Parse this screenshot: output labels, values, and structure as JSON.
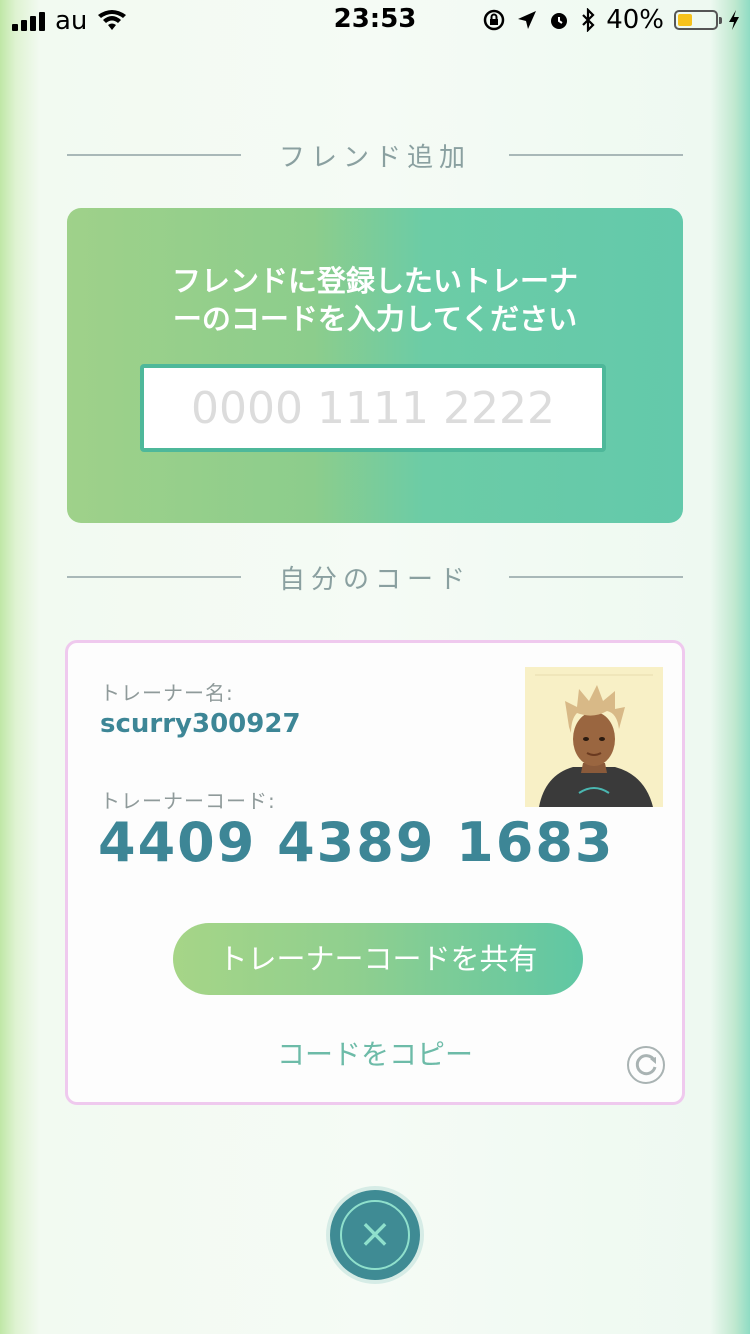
{
  "status_bar": {
    "carrier": "au",
    "time": "23:53",
    "battery_percent": "40%",
    "battery_level": 0.4,
    "icons": [
      "signal-bars-icon",
      "wifi-icon",
      "orientation-lock-icon",
      "location-arrow-icon",
      "alarm-icon",
      "bluetooth-icon",
      "battery-icon",
      "charging-bolt-icon"
    ]
  },
  "add_friend": {
    "section_title": "フレンド追加",
    "prompt_line1": "フレンドに登録したいトレーナ",
    "prompt_line2": "ーのコードを入力してください",
    "code_placeholder": "0000 1111 2222",
    "code_value": ""
  },
  "my_code": {
    "section_title": "自分のコード",
    "trainer_name_label": "トレーナー名:",
    "trainer_name": "scurry300927",
    "trainer_code_label": "トレーナーコード:",
    "trainer_code": "4409 4389 1683",
    "share_button": "トレーナーコードを共有",
    "copy_link": "コードをコピー"
  },
  "colors": {
    "accent_green": "#8ccd8c",
    "accent_teal": "#63c9ab",
    "code_text": "#3d8696",
    "card_border": "#efc9ee",
    "close_button": "#3f8b94"
  }
}
